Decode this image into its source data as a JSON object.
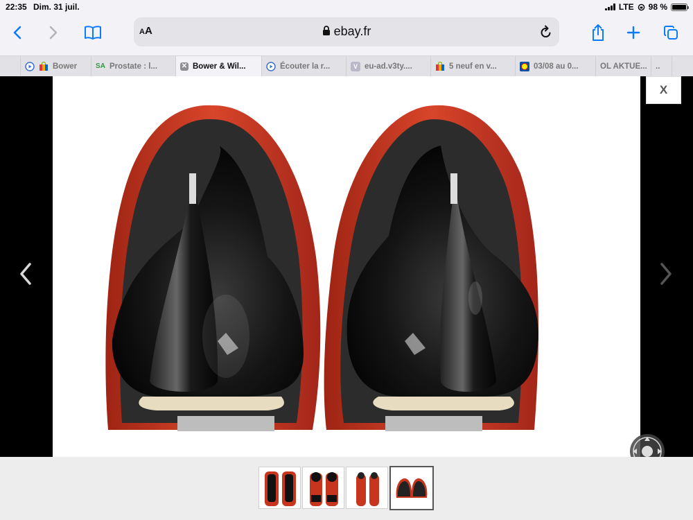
{
  "status_bar": {
    "time": "22:35",
    "date": "Dim. 31 juil.",
    "network": "LTE",
    "battery": "98 %",
    "battery_level": 0.98
  },
  "toolbar": {
    "text_size_label": "AA",
    "host": "ebay.fr",
    "icons": [
      "back-icon",
      "forward-icon",
      "bookmarks-icon",
      "lock-icon",
      "reload-icon",
      "share-icon",
      "new-tab-icon",
      "tabs-overview-icon"
    ]
  },
  "tabs": [
    {
      "label": "Bower",
      "favicon": "play-circle",
      "favicon2": "ebay-bag",
      "active": false
    },
    {
      "label": "Prostate : l...",
      "favicon": "SA",
      "active": false
    },
    {
      "label": "Bower & Wil...",
      "favicon": "close",
      "active": true
    },
    {
      "label": "Écouter la r...",
      "favicon": "play-circle",
      "active": false
    },
    {
      "label": "eu-ad.v3ty....",
      "favicon": "V",
      "active": false
    },
    {
      "label": "5 neuf en v...",
      "favicon": "ebay-bag",
      "active": false
    },
    {
      "label": "03/08 au 0...",
      "favicon": "Lidl",
      "active": false
    },
    {
      "label": "OL AKTUE...",
      "favicon": "",
      "active": false
    },
    {
      "label": "..",
      "favicon": "",
      "active": false
    }
  ],
  "viewer": {
    "close_label": "X",
    "prev_icon": "chevron-left-icon",
    "next_icon": "chevron-right-icon",
    "pan_control_icon": "pan-joystick-icon",
    "image_subject": "speakers-top-view"
  },
  "thumbnails": [
    {
      "name": "thumb-1",
      "active": false
    },
    {
      "name": "thumb-2",
      "active": false
    },
    {
      "name": "thumb-3",
      "active": false
    },
    {
      "name": "thumb-4",
      "active": true
    }
  ],
  "colors": {
    "accent": "#0a7aff",
    "speaker_wood": "#c8351f",
    "speaker_gloss": "#141414"
  }
}
